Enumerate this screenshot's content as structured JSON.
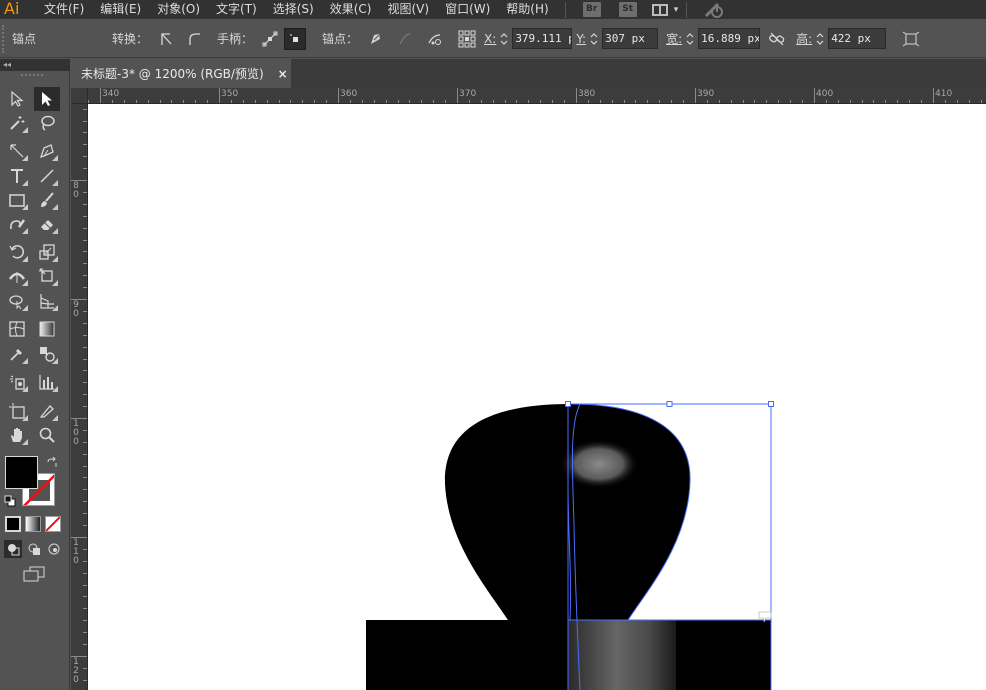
{
  "app": {
    "logo": "Ai",
    "accent": "#f79500"
  },
  "menu": {
    "items": [
      "文件(F)",
      "编辑(E)",
      "对象(O)",
      "文字(T)",
      "选择(S)",
      "效果(C)",
      "视图(V)",
      "窗口(W)",
      "帮助(H)"
    ],
    "bridge_label": "Br",
    "stock_label": "St"
  },
  "control": {
    "selection_label": "锚点",
    "convert_label": "转换：",
    "handles_label": "手柄：",
    "anchors_label": "锚点：",
    "x_label": "X:",
    "x_value": "379.111 p",
    "y_label": "Y:",
    "y_value": "307 px",
    "w_label": "宽:",
    "w_value": "16.889 px",
    "h_label": "高:",
    "h_value": "422 px"
  },
  "panel": {
    "collapse_glyph": "◂◂"
  },
  "document": {
    "tab_title": "未标题-3* @ 1200% (RGB/预览)",
    "close_glyph": "×"
  },
  "rulers": {
    "horizontal": [
      "340",
      "350",
      "360",
      "370",
      "380",
      "390",
      "400",
      "410"
    ],
    "vertical": [
      "80",
      "90",
      "100",
      "110",
      "120"
    ]
  },
  "colors": {
    "fill": "#000000",
    "stroke": "none",
    "selection": "#4a6dff",
    "artboard": "#ffffff"
  },
  "tools": {
    "selected": "direct-selection-tool"
  }
}
